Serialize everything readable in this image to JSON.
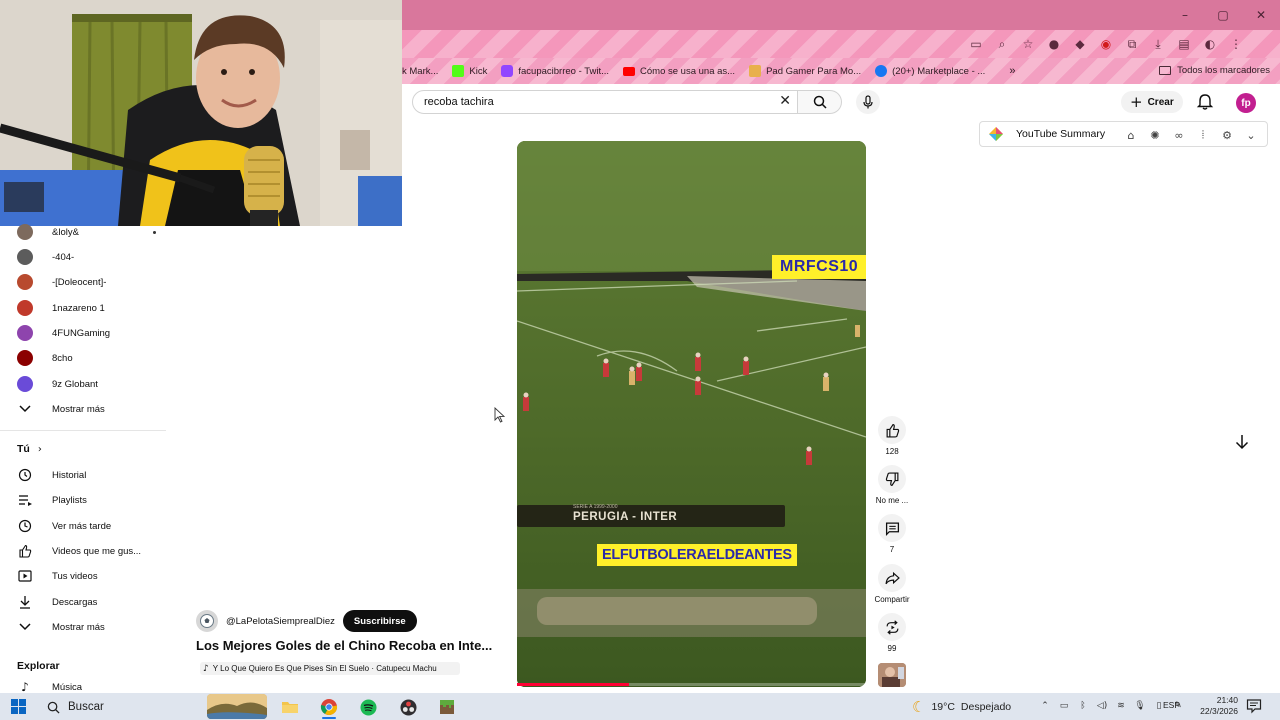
{
  "browser": {
    "window_controls": [
      "–",
      "▢",
      "✕"
    ],
    "bookmarks": [
      {
        "label": "k Mark...",
        "icon": "marketplace-icon",
        "color": "#e05a00"
      },
      {
        "label": "Kick",
        "icon": "kick-icon",
        "color": "#53fc18"
      },
      {
        "label": "facupacibrreo - Twit...",
        "icon": "twitch-icon",
        "color": "#9146ff"
      },
      {
        "label": "Cómo se usa una as...",
        "icon": "youtube-icon",
        "color": "#ff0000"
      },
      {
        "label": "Pad Gamer Para Mo...",
        "icon": "shop-icon",
        "color": "#e8b04c"
      },
      {
        "label": "(20+) Marketplace - ...",
        "icon": "facebook-icon",
        "color": "#1877f2"
      }
    ],
    "bookmarks_overflow": "»",
    "all_bookmarks": "Todos los marcadores"
  },
  "youtube": {
    "search": {
      "value": "recoba tachira"
    },
    "create_label": "Crear",
    "avatar_initials": "fp"
  },
  "extension": {
    "label": "YouTube Summary"
  },
  "sidebar": {
    "subscriptions": [
      {
        "label": "&loly&",
        "color": "#7d6a5d"
      },
      {
        "label": "-404-",
        "color": "#5c5c5c"
      },
      {
        "label": "-[Doleocent]-",
        "color": "#b84a2e"
      },
      {
        "label": "1nazareno 1",
        "color": "#c0392b"
      },
      {
        "label": "4FUNGaming",
        "color": "#8e44ad"
      },
      {
        "label": "8cho",
        "color": "#8b0000"
      },
      {
        "label": "9z Globant",
        "color": "#6a4bd8"
      }
    ],
    "show_more_1": "Mostrar más",
    "you_heading": "Tú",
    "you_items": [
      {
        "label": "Historial",
        "icon": "history-icon"
      },
      {
        "label": "Playlists",
        "icon": "playlists-icon"
      },
      {
        "label": "Ver más tarde",
        "icon": "watch-later-icon"
      },
      {
        "label": "Videos que me gus...",
        "icon": "liked-videos-icon"
      },
      {
        "label": "Tus videos",
        "icon": "your-videos-icon"
      },
      {
        "label": "Descargas",
        "icon": "downloads-icon"
      }
    ],
    "show_more_2": "Mostrar más",
    "explore_heading": "Explorar",
    "explore_items": [
      {
        "label": "Música",
        "icon": "music-icon"
      }
    ]
  },
  "video": {
    "overlay_top": "MRFCS10",
    "scoreboard_small": "SERIE A 1999-2000",
    "scoreboard": "PERUGIA - INTER",
    "overlay_bottom": "ELFUTBOLERAELDEANTES",
    "progress_percent": 32
  },
  "actions": {
    "likes": "128",
    "dislike_label": "No me ...",
    "comments": "7",
    "share_label": "Compartir",
    "remix_count": "99"
  },
  "info": {
    "channel": "@LaPelotaSiemprealDiez",
    "subscribe_label": "Suscribirse",
    "title": "Los Mejores Goles de el Chino Recoba en Inte...",
    "song": "Y Lo Que Quiero Es Que Pises Sin El Suelo · Catupecu Machu"
  },
  "taskbar": {
    "search_label": "Buscar",
    "weather_temp": "19°C",
    "weather_desc": "Despejado",
    "lang": "ESP",
    "time": "21:40",
    "date": "22/3/2026"
  },
  "colors": {
    "accent": "#ff0033",
    "chrome_pink": "#f497bb",
    "avatar": "#c21f90",
    "overlay_yellow": "#fff02a"
  }
}
